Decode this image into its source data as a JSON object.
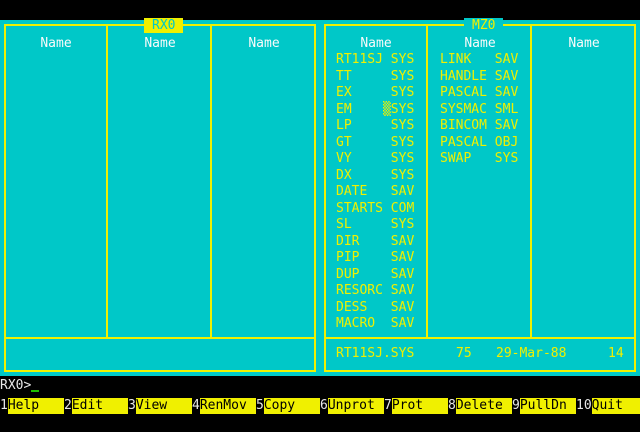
{
  "left_panel": {
    "title": "RX0",
    "column_headers": [
      "Name",
      "Name",
      "Name"
    ]
  },
  "right_panel": {
    "title": "MZ0",
    "column_headers": [
      "Name",
      "Name",
      "Name"
    ],
    "col1": [
      "RT11SJ SYS",
      "TT     SYS",
      "EX     SYS",
      "EM    ▒SYS",
      "LP     SYS",
      "GT     SYS",
      "VY     SYS",
      "DX     SYS",
      "DATE   SAV",
      "STARTS COM",
      "SL     SYS",
      "DIR    SAV",
      "PIP    SAV",
      "DUP    SAV",
      "RESORC SAV",
      "DESS   SAV",
      "MACRO  SAV"
    ],
    "col2": [
      "LINK   SAV",
      "HANDLE SAV",
      "PASCAL SAV",
      "SYSMAC SML",
      "BINCOM SAV",
      "PASCAL OBJ",
      "SWAP   SYS"
    ],
    "status": {
      "file": "RT11SJ.SYS",
      "size": "75",
      "date": "29-Mar-88",
      "extra": "14"
    }
  },
  "command_line": {
    "prompt": "RX0>"
  },
  "function_keys": [
    {
      "num": "1",
      "label": "Help"
    },
    {
      "num": "2",
      "label": "Edit"
    },
    {
      "num": "3",
      "label": "View"
    },
    {
      "num": "4",
      "label": "RenMov"
    },
    {
      "num": "5",
      "label": "Copy"
    },
    {
      "num": "6",
      "label": "Unprot"
    },
    {
      "num": "7",
      "label": "Prot"
    },
    {
      "num": "8",
      "label": "Delete"
    },
    {
      "num": "9",
      "label": "PullDn"
    },
    {
      "num": "10",
      "label": "Quit"
    }
  ],
  "colors": {
    "panel_bg": "#00c8c8",
    "frame": "#f0f000",
    "text": "#f0f000",
    "header": "#fafafa"
  }
}
